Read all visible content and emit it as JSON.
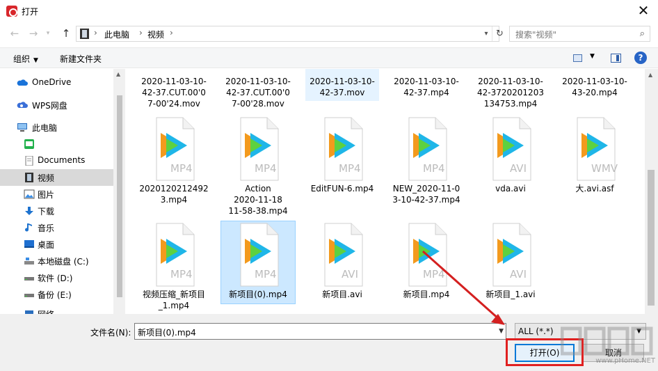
{
  "window": {
    "title": "打开"
  },
  "nav": {
    "address": {
      "crumbs": [
        "此电脑",
        "视频"
      ],
      "sep": "›"
    },
    "search_placeholder": "搜索\"视频\""
  },
  "toolbar": {
    "organize": "组织",
    "new_folder": "新建文件夹"
  },
  "sidebar": {
    "items": [
      {
        "label": "OneDrive",
        "icon": "cloud-icon"
      },
      {
        "label": "WPS网盘",
        "icon": "wps-cloud-icon"
      },
      {
        "label": "此电脑",
        "icon": "computer-icon"
      },
      {
        "label": "",
        "icon": "wechat-files-icon"
      },
      {
        "label": "Documents",
        "icon": "document-icon"
      },
      {
        "label": "视频",
        "icon": "video-icon",
        "selected": true
      },
      {
        "label": "图片",
        "icon": "picture-icon"
      },
      {
        "label": "下载",
        "icon": "download-icon"
      },
      {
        "label": "音乐",
        "icon": "music-icon"
      },
      {
        "label": "桌面",
        "icon": "desktop-icon"
      },
      {
        "label": "本地磁盘 (C:)",
        "icon": "drive-c-icon"
      },
      {
        "label": "软件 (D:)",
        "icon": "drive-d-icon"
      },
      {
        "label": "备份 (E:)",
        "icon": "drive-e-icon"
      },
      {
        "label": "网络",
        "icon": "network-icon"
      }
    ]
  },
  "files": {
    "row1": [
      {
        "lines": [
          "2020-11-03-10-",
          "42-37.CUT.00'0",
          "7-00'24.mov"
        ]
      },
      {
        "lines": [
          "2020-11-03-10-",
          "42-37.CUT.00'0",
          "7-00'28.mov"
        ]
      },
      {
        "lines": [
          "2020-11-03-10-",
          "42-37.mov"
        ]
      },
      {
        "lines": [
          "2020-11-03-10-",
          "42-37.mp4"
        ]
      },
      {
        "lines": [
          "2020-11-03-10-",
          "42-3720201203",
          "134753.mp4"
        ]
      },
      {
        "lines": [
          "2020-11-03-10-",
          "43-20.mp4"
        ]
      }
    ],
    "row2": [
      {
        "ext": "MP4",
        "lines": [
          "2020120212492",
          "3.mp4"
        ]
      },
      {
        "ext": "MP4",
        "lines": [
          "Action",
          "2020-11-18",
          "11-58-38.mp4"
        ]
      },
      {
        "ext": "MP4",
        "lines": [
          "EditFUN-6.mp4"
        ]
      },
      {
        "ext": "MP4",
        "lines": [
          "NEW_2020-11-0",
          "3-10-42-37.mp4"
        ]
      },
      {
        "ext": "AVI",
        "lines": [
          "vda.avi"
        ]
      },
      {
        "ext": "WMV",
        "lines": [
          "大.avi.asf"
        ]
      }
    ],
    "row3": [
      {
        "ext": "MP4",
        "lines": [
          "视频压缩_新项目",
          "_1.mp4"
        ]
      },
      {
        "ext": "MP4",
        "lines": [
          "新项目(0).mp4"
        ]
      },
      {
        "ext": "AVI",
        "lines": [
          "新项目.avi"
        ]
      },
      {
        "ext": "MP4",
        "lines": [
          "新项目.mp4"
        ]
      },
      {
        "ext": "AVI",
        "lines": [
          "新项目_1.avi"
        ]
      }
    ]
  },
  "bottom": {
    "filename_label": "文件名(N):",
    "filename_value": "新项目(0).mp4",
    "filetype_value": "ALL (*.*)",
    "open_label": "打开(O)",
    "cancel_label": "取消"
  },
  "watermark": {
    "text": "www.pHome.NET"
  },
  "colors": {
    "accent": "#0078d7",
    "annotation": "#e02020",
    "selection": "#cce8ff"
  }
}
